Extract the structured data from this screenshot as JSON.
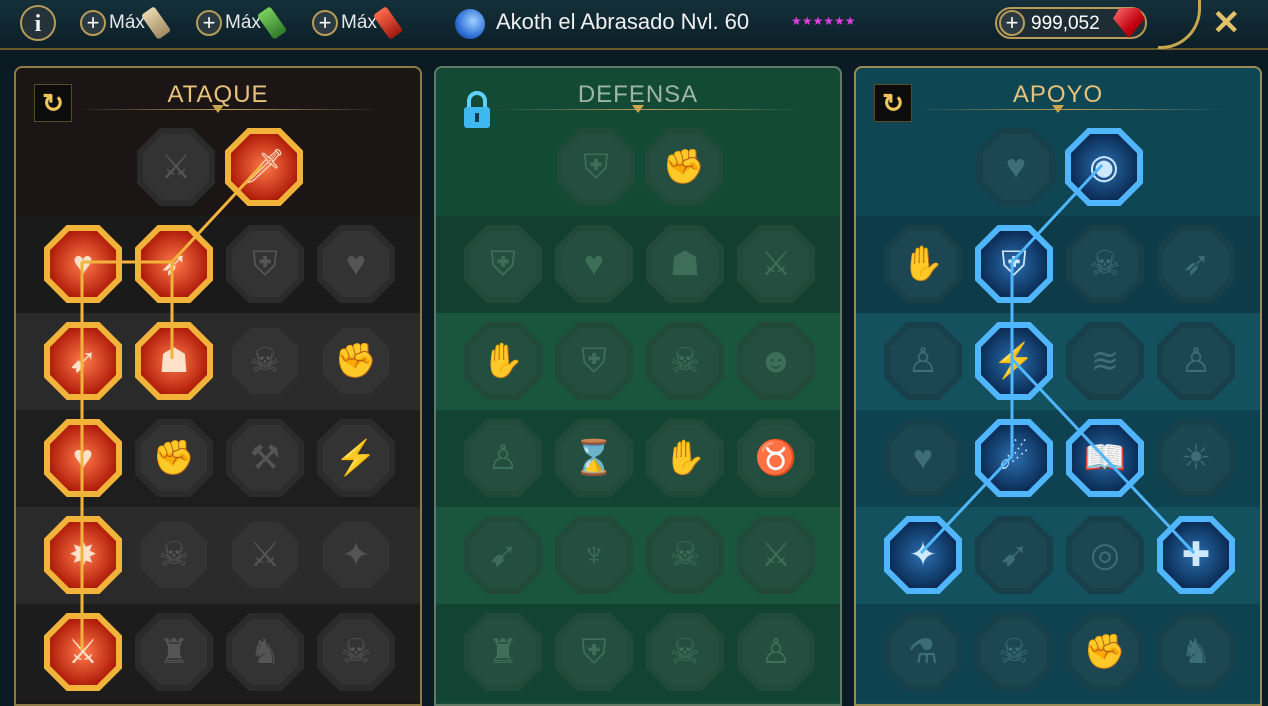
{
  "topbar": {
    "info_label": "i",
    "max_buttons": [
      "Máx",
      "Máx",
      "Máx"
    ],
    "hero_name": "Akoth el Abrasado Nvl. 60",
    "stars": "★★★★★★",
    "gems_value": "999,052",
    "close_label": "✕"
  },
  "panels": {
    "attack": {
      "title": "ATAQUE",
      "reset_icon": "↻"
    },
    "defense": {
      "title": "DEFENSA"
    },
    "support": {
      "title": "APOYO",
      "reset_icon": "↻"
    }
  },
  "colors": {
    "attack_active": "#f1b33a",
    "support_active": "#4fb6ff",
    "gold": "#c9a54e"
  }
}
